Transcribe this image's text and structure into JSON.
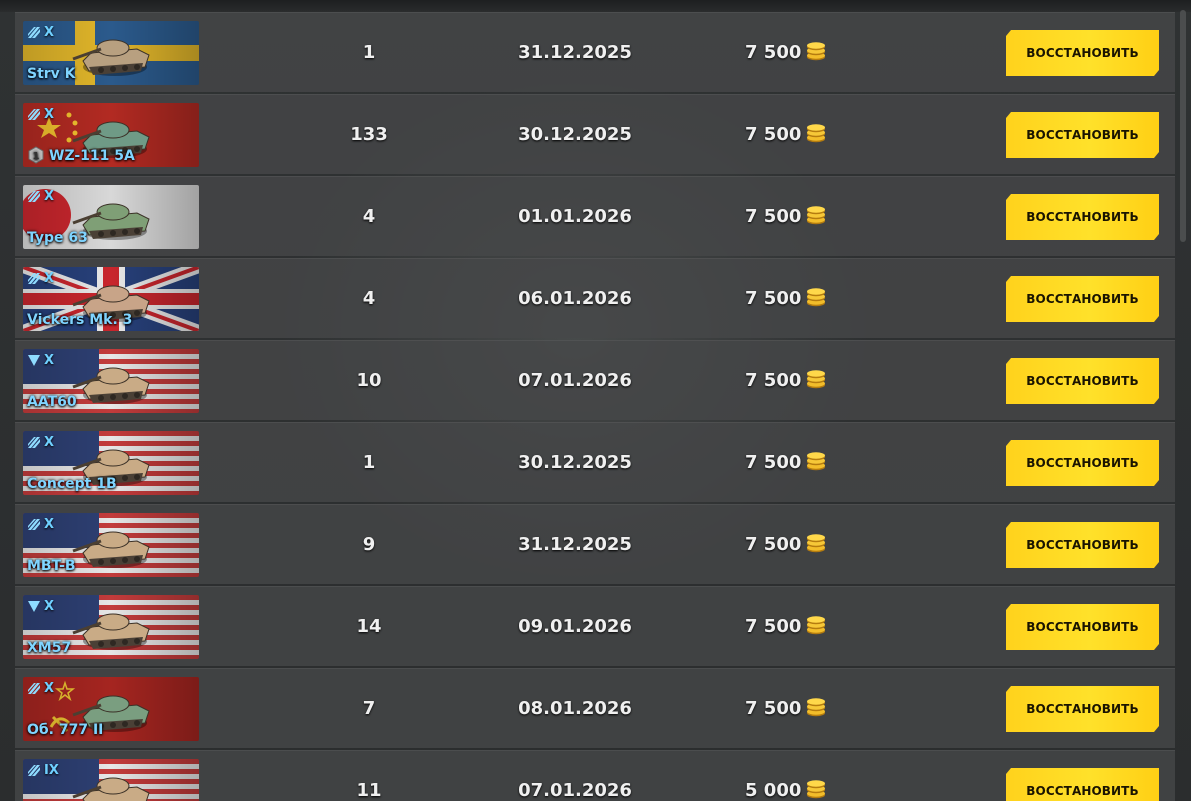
{
  "restore_label": "ВОССТАНОВИТЬ",
  "colors": {
    "accent": "#ffd21c",
    "name_text": "#7fd4ff",
    "row_bg": "#464849"
  },
  "rows": [
    {
      "name": "Strv K",
      "tier": "X",
      "vehicle_class": "heavy-tank",
      "nation": "sweden",
      "mastery": "",
      "count": "1",
      "date": "31.12.2025",
      "price": "7 500"
    },
    {
      "name": "WZ-111 5A",
      "tier": "X",
      "vehicle_class": "heavy-tank",
      "nation": "china",
      "mastery": "1",
      "count": "133",
      "date": "30.12.2025",
      "price": "7 500"
    },
    {
      "name": "Type 63",
      "tier": "X",
      "vehicle_class": "heavy-tank",
      "nation": "japan",
      "mastery": "",
      "count": "4",
      "date": "01.01.2026",
      "price": "7 500"
    },
    {
      "name": "Vickers Mk. 3",
      "tier": "X",
      "vehicle_class": "heavy-tank",
      "nation": "uk",
      "mastery": "",
      "count": "4",
      "date": "06.01.2026",
      "price": "7 500"
    },
    {
      "name": "AAT60",
      "tier": "X",
      "vehicle_class": "tank-destroyer",
      "nation": "usa",
      "mastery": "",
      "count": "10",
      "date": "07.01.2026",
      "price": "7 500"
    },
    {
      "name": "Concept 1B",
      "tier": "X",
      "vehicle_class": "heavy-tank",
      "nation": "usa",
      "mastery": "",
      "count": "1",
      "date": "30.12.2025",
      "price": "7 500"
    },
    {
      "name": "MBT-B",
      "tier": "X",
      "vehicle_class": "heavy-tank",
      "nation": "usa",
      "mastery": "",
      "count": "9",
      "date": "31.12.2025",
      "price": "7 500"
    },
    {
      "name": "XM57",
      "tier": "X",
      "vehicle_class": "tank-destroyer",
      "nation": "usa",
      "mastery": "",
      "count": "14",
      "date": "09.01.2026",
      "price": "7 500"
    },
    {
      "name": "Об. 777 II",
      "tier": "X",
      "vehicle_class": "heavy-tank",
      "nation": "ussr",
      "mastery": "",
      "count": "7",
      "date": "08.01.2026",
      "price": "7 500"
    },
    {
      "name": "",
      "tier": "IX",
      "vehicle_class": "heavy-tank",
      "nation": "usa",
      "mastery": "",
      "count": "11",
      "date": "07.01.2026",
      "price": "5 000"
    }
  ]
}
